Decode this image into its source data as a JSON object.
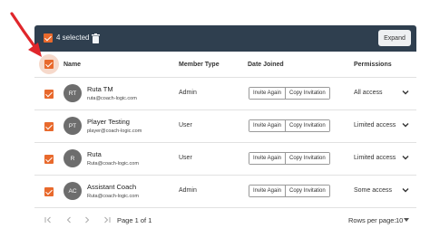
{
  "selection_bar": {
    "count_text": "4 selected",
    "expand_label": "Expand"
  },
  "table": {
    "headers": {
      "name": "Name",
      "member_type": "Member Type",
      "date_joined": "Date Joined",
      "permissions": "Permissions"
    },
    "rows": [
      {
        "initials": "RT",
        "name": "Ruta TM",
        "email": "ruta@coach-logic.com",
        "member_type": "Admin",
        "invite_label": "Invite Again",
        "copy_label": "Copy Invitation",
        "permissions": "All access"
      },
      {
        "initials": "PT",
        "name": "Player Testing",
        "email": "player@coach-logic.com",
        "member_type": "User",
        "invite_label": "Invite Again",
        "copy_label": "Copy Invitation",
        "permissions": "Limited access"
      },
      {
        "initials": "R",
        "name": "Ruta",
        "email": "Ruta@coach-logic.com",
        "member_type": "User",
        "invite_label": "Invite Again",
        "copy_label": "Copy Invitation",
        "permissions": "Limited access"
      },
      {
        "initials": "AC",
        "name": "Assistant Coach",
        "email": "Ruta@coach-logic.com",
        "member_type": "Admin",
        "invite_label": "Invite Again",
        "copy_label": "Copy Invitation",
        "permissions": "Some access"
      }
    ]
  },
  "pagination": {
    "page_text": "Page 1 of 1",
    "rows_per_page_label": "Rows per page:",
    "rows_per_page_value": "10"
  },
  "colors": {
    "accent": "#e8692c",
    "header_bar": "#2f3f4f",
    "annotation_arrow": "#e0262b"
  },
  "icons": [
    "trash-icon",
    "chevron-down-icon",
    "first-page-icon",
    "prev-page-icon",
    "next-page-icon",
    "last-page-icon",
    "caret-down-icon",
    "annotation-arrow"
  ]
}
